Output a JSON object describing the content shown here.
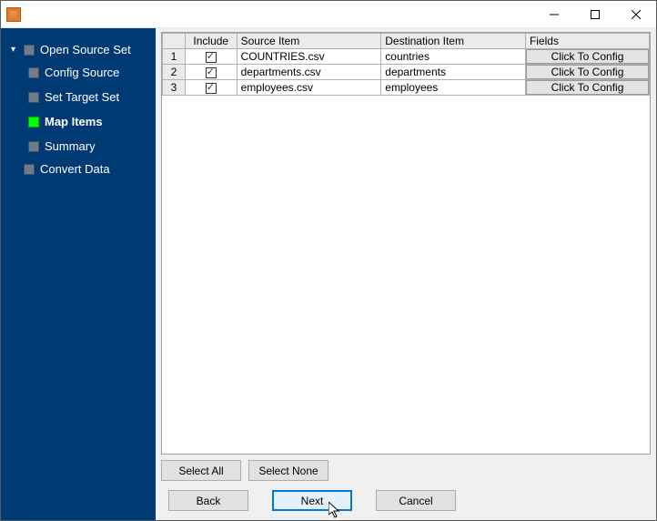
{
  "sidebar": {
    "root": {
      "label": "Open Source Set"
    },
    "children": [
      {
        "label": "Config Source",
        "active": false
      },
      {
        "label": "Set Target Set",
        "active": false
      },
      {
        "label": "Map Items",
        "active": true
      },
      {
        "label": "Summary",
        "active": false
      }
    ],
    "last": {
      "label": "Convert Data"
    }
  },
  "table": {
    "headers": {
      "include": "Include",
      "source": "Source Item",
      "destination": "Destination Item",
      "fields": "Fields"
    },
    "config_button_label": "Click To Config",
    "rows": [
      {
        "n": "1",
        "include": true,
        "source": "COUNTRIES.csv",
        "destination": "countries"
      },
      {
        "n": "2",
        "include": true,
        "source": "departments.csv",
        "destination": "departments"
      },
      {
        "n": "3",
        "include": true,
        "source": "employees.csv",
        "destination": "employees"
      }
    ]
  },
  "buttons": {
    "select_all": "Select All",
    "select_none": "Select None",
    "back": "Back",
    "next": "Next",
    "cancel": "Cancel"
  }
}
